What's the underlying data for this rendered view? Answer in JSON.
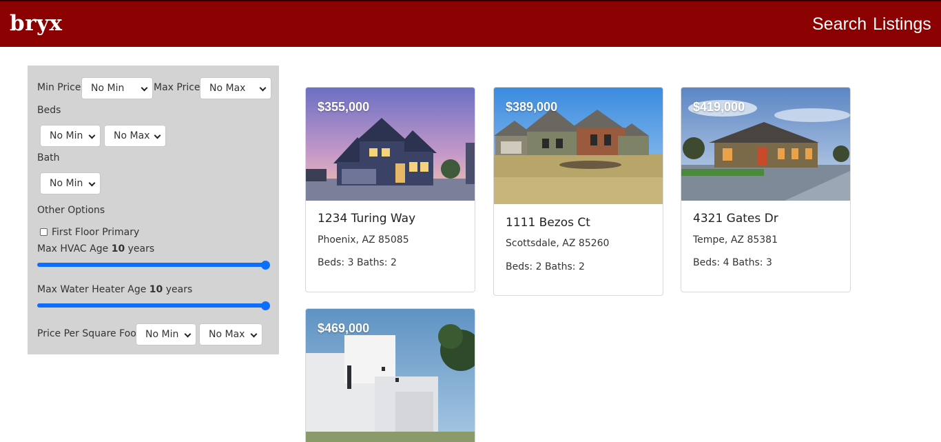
{
  "header": {
    "brand": "bryx",
    "nav": {
      "search": "Search",
      "listings": "Listings"
    }
  },
  "filters": {
    "min_price": {
      "label": "Min Price",
      "value": "No Min"
    },
    "max_price": {
      "label": "Max Price",
      "value": "No Max"
    },
    "beds": {
      "label": "Beds",
      "min": "No Min",
      "max": "No Max"
    },
    "bath": {
      "label": "Bath",
      "min": "No Min"
    },
    "other_options": "Other Options",
    "first_floor_primary": {
      "label": "First Floor Primary",
      "checked": false
    },
    "hvac": {
      "prefix": "Max HVAC Age",
      "value": "10",
      "suffix": "years",
      "slider_fraction": 1.0
    },
    "water_heater": {
      "prefix": "Max Water Heater Age",
      "value": "10",
      "suffix": "years",
      "slider_fraction": 1.0
    },
    "price_per_sqft": {
      "label": "Price Per Square Foot",
      "min": "No Min",
      "max": "No Max"
    }
  },
  "listings": [
    {
      "price": "$355,000",
      "address": "1234 Turing Way",
      "city": "Phoenix, AZ 85085",
      "beds_label": "Beds:",
      "beds": "3",
      "baths_label": "Baths:",
      "baths": "2"
    },
    {
      "price": "$389,000",
      "address": "1111 Bezos Ct",
      "city": "Scottsdale, AZ 85260",
      "beds_label": "Beds:",
      "beds": "2",
      "baths_label": "Baths:",
      "baths": "2"
    },
    {
      "price": "$419,000",
      "address": "4321 Gates Dr",
      "city": "Tempe, AZ 85381",
      "beds_label": "Beds:",
      "beds": "4",
      "baths_label": "Baths:",
      "baths": "3"
    },
    {
      "price": "$469,000"
    }
  ],
  "colors": {
    "header": "#8b0000",
    "sidebar": "#d3d3d3",
    "accent": "#0d6efd"
  }
}
